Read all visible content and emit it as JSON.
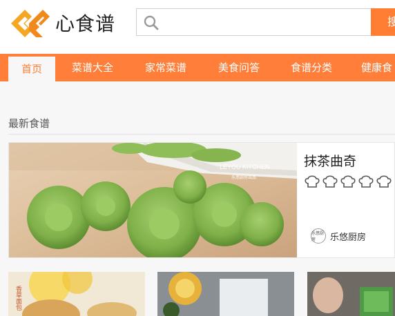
{
  "brand": {
    "name": "心食谱",
    "accent": "#ff7e33"
  },
  "search": {
    "placeholder": "",
    "button_label": "搜"
  },
  "nav": {
    "items": [
      "首页",
      "菜谱大全",
      "家常菜谱",
      "美食问答",
      "食谱分类",
      "健康食"
    ]
  },
  "section": {
    "title": "最新食谱"
  },
  "featured": {
    "title": "抹茶曲奇",
    "rating_stars": 5,
    "rating_filled": 0,
    "author": "乐悠厨房",
    "avatar_text": "乐悠厨房",
    "watermark": "LEYOU KITCHEN",
    "watermark_sub": "乐悠厨房出品"
  },
  "thumbnails": [
    {
      "label": "香草面包"
    },
    {
      "label": ""
    },
    {
      "label": ""
    }
  ]
}
